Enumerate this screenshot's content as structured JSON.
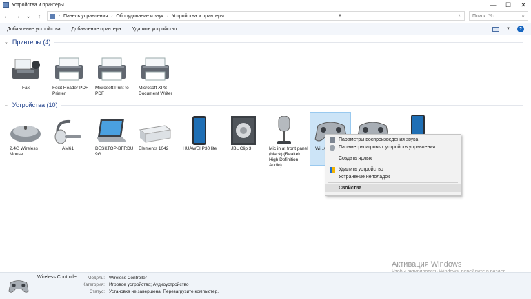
{
  "window": {
    "title": "Устройства и принтеры",
    "buttons": {
      "minimize": "—",
      "maximize": "☐",
      "close": "✕"
    }
  },
  "address": {
    "back": "←",
    "forward": "→",
    "history": "⌄",
    "up": "↑",
    "crumbs": [
      "Панель управления",
      "Оборудование и звук",
      "Устройства и принтеры"
    ],
    "search_placeholder": "Поиск: Устройства и принтеры",
    "search_short": "Поиск: Ус..."
  },
  "toolbar": {
    "add_device": "Добавление устройства",
    "add_printer": "Добавление принтера",
    "remove_device": "Удалить устройство",
    "help": "?"
  },
  "printers": {
    "header": "Принтеры (4)",
    "items": [
      {
        "label": "Fax",
        "icon": "fax-icon"
      },
      {
        "label": "Foxit Reader PDF Printer",
        "icon": "printer-icon"
      },
      {
        "label": "Microsoft Print to PDF",
        "icon": "printer-icon"
      },
      {
        "label": "Microsoft XPS Document Writer",
        "icon": "printer-icon"
      }
    ]
  },
  "devices": {
    "header": "Устройства (10)",
    "items": [
      {
        "label": "2.4G Wireless Mouse",
        "icon": "mouse-icon"
      },
      {
        "label": "AM61",
        "icon": "headset-icon"
      },
      {
        "label": "DESKTOP-BFRDU 9G",
        "icon": "laptop-icon"
      },
      {
        "label": "Elements 1042",
        "icon": "hard-drive-icon"
      },
      {
        "label": "HUAWEI P30 lite",
        "icon": "phone-icon"
      },
      {
        "label": "JBL Clip 3",
        "icon": "speaker-icon"
      },
      {
        "label": "Mic in at front panel (black) (Realtek High Definition Audio)",
        "icon": "microphone-icon"
      },
      {
        "label": "Wi...Co...",
        "icon": "gamepad-icon"
      },
      {
        "label": "",
        "icon": "gamepad-icon"
      },
      {
        "label": "",
        "icon": "phone-icon"
      }
    ]
  },
  "context_menu": {
    "sound": "Параметры воспроизведения звука",
    "game": "Параметры игровых устройств управления",
    "shortcut": "Создать ярлык",
    "remove": "Удалить устройство",
    "troubleshoot": "Устранение неполадок",
    "properties": "Свойства"
  },
  "details": {
    "title": "Wireless Controller",
    "model_key": "Модель:",
    "model_val": "Wireless Controller",
    "category_key": "Категория:",
    "category_val": "Игровое устройство; Аудиоустройство",
    "status_key": "Статус:",
    "status_val": "Установка не завершена. Перезагрузите компьютер."
  },
  "activation": {
    "line1": "Активация Windows",
    "line2": "Чтобы активировать Windows, перейдите в раздел \"Параметры\"."
  },
  "colors": {
    "accent": "#1565c0",
    "selection": "#cce4f7",
    "group_header": "#1e3f8a"
  }
}
